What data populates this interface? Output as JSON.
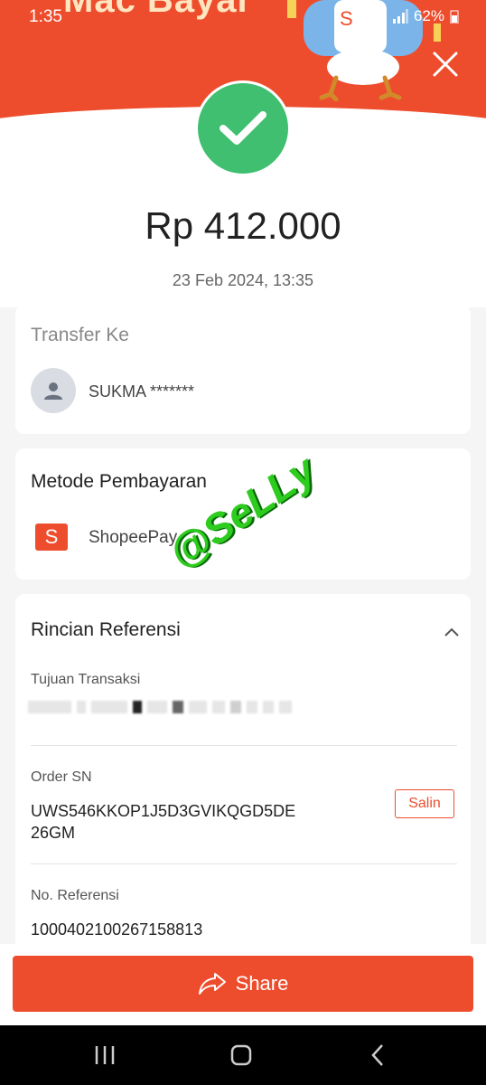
{
  "status_bar": {
    "time": "1:35",
    "battery": "62%",
    "network": "4G+"
  },
  "header": {
    "banner_text": "Mac Bayar"
  },
  "result": {
    "amount": "Rp 412.000",
    "datetime": "23 Feb 2024, 13:35"
  },
  "transfer": {
    "title": "Transfer Ke",
    "recipient": "SUKMA *******"
  },
  "payment_method": {
    "title": "Metode Pembayaran",
    "method": "ShopeePay",
    "icon_letter": "S"
  },
  "watermark": {
    "text": "@SeLLy"
  },
  "reference": {
    "title": "Rincian Referensi",
    "purpose_label": "Tujuan Transaksi",
    "order_sn_label": "Order SN",
    "order_sn_line1": "UWS546KKOP1J5D3GVIKQGD5DE",
    "order_sn_line2": "26GM",
    "copy_label": "Salin",
    "ref_no_label": "No. Referensi",
    "ref_no": "1000402100267158813"
  },
  "share": {
    "label": "Share"
  },
  "colors": {
    "brand": "#ee4d2d",
    "success": "#3fbf6f"
  },
  "icons": [
    "close-icon",
    "checkmark-icon",
    "person-icon",
    "shopeepay-icon",
    "chevron-up-icon",
    "share-arrow-icon",
    "recents-icon",
    "home-icon",
    "back-icon"
  ]
}
